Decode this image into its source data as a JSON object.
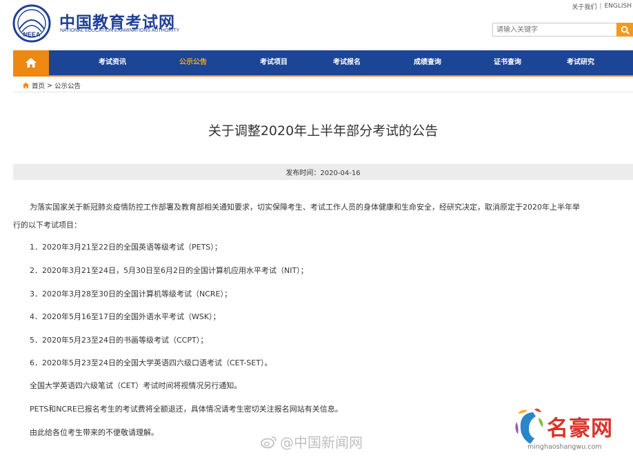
{
  "topbar": {
    "about": "关于我们",
    "sep": "|",
    "english": "ENGLISH"
  },
  "brand": {
    "cn": "中国教育考试网",
    "en": "NATIONAL EDUCATION EXAMINATIONS AUTHORITY",
    "logo_text": "NEEA"
  },
  "search": {
    "placeholder": "请输入关键字"
  },
  "nav": {
    "items": [
      {
        "label": "考试资讯"
      },
      {
        "label": "公示公告",
        "active": true
      },
      {
        "label": "考试项目"
      },
      {
        "label": "考试报名"
      },
      {
        "label": "成绩查询"
      },
      {
        "label": "证书查询"
      },
      {
        "label": "考试研究"
      }
    ]
  },
  "breadcrumb": {
    "home": "首页",
    "sep": ">",
    "current": "公示公告"
  },
  "article": {
    "title": "关于调整2020年上半年部分考试的公告",
    "date_label": "发布时间：2020-04-16",
    "intro_line1": "为落实国家关于新冠肺炎疫情防控工作部署及教育部相关通知要求，切实保障考生、考试工作人员的身体健康和生命安全，经研究决定，取消原定于2020年上半年举",
    "intro_line2": "行的以下考试项目：",
    "items": [
      "1．2020年3月21至22日的全国英语等级考试（PETS）；",
      "2．2020年3月21至24日，5月30日至6月2日的全国计算机应用水平考试（NIT）；",
      "3．2020年3月28至30日的全国计算机等级考试（NCRE）；",
      "4．2020年5月16至17日的全国外语水平考试（WSK）；",
      "5．2020年5月23至24日的书画等级考试（CCPT）；",
      "6．2020年5月23至24日的全国大学英语四六级口语考试（CET-SET）。"
    ],
    "cet_note": "全国大学英语四六级笔试（CET）考试时间将视情况另行通知。",
    "refund_note": "PETS和NCRE已报名考生的考试费将全额退还，具体情况请考生密切关注报名网站有关信息。",
    "apology": "由此给各位考生带来的不便敬请理解。"
  },
  "watermarks": {
    "weibo": "@中国新闻网",
    "site_cn": "名豪网",
    "site_en": "minghaoshangwu.com"
  },
  "colors": {
    "nav_bg": "#1c4595",
    "accent": "#ee8810",
    "active_nav": "#f6a52a",
    "brand_blue": "#1f3f93",
    "watermark_red": "#d9332a"
  }
}
